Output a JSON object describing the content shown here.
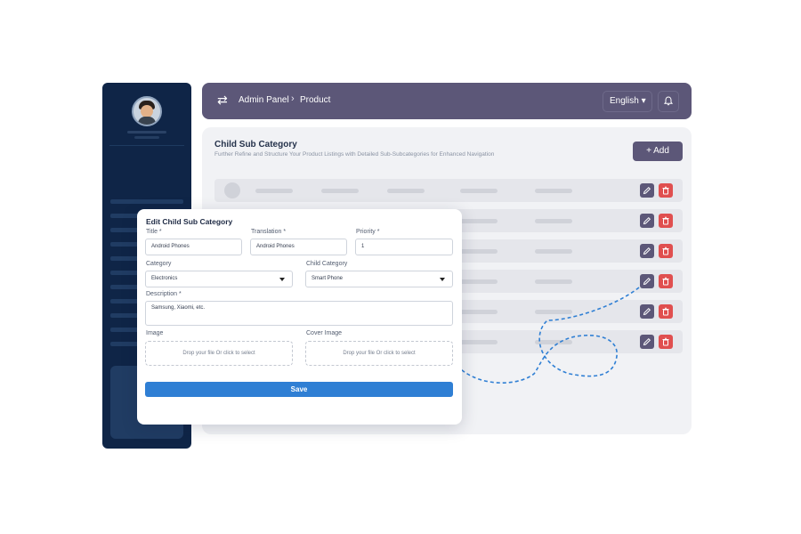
{
  "header": {
    "swap_icon": "⇄",
    "breadcrumb": [
      "Admin Panel",
      "Product"
    ],
    "breadcrumb_separator": "›",
    "language": "English ▾",
    "bell_icon": "bell-icon"
  },
  "main": {
    "title": "Child Sub Category",
    "subtitle": "Further Refine and Structure Your Product Listings with Detailed Sub-Subcategories for Enhanced Navigation",
    "add_label": "+ Add",
    "row_count": 6
  },
  "modal": {
    "title": "Edit Child Sub Category",
    "fields": {
      "title": {
        "label": "Title *",
        "value": "Android Phones"
      },
      "translation": {
        "label": "Translation *",
        "value": "Android Phones"
      },
      "priority": {
        "label": "Priority *",
        "value": "1"
      },
      "category": {
        "label": "Category",
        "value": "Electronics"
      },
      "child_category": {
        "label": "Child Category",
        "value": "Smart Phone"
      },
      "description": {
        "label": "Description *",
        "value": "Samsung, Xiaomi, etc."
      },
      "image": {
        "label": "Image",
        "placeholder": "Drop your file Or click to select"
      },
      "cover_image": {
        "label": "Cover Image",
        "placeholder": "Drop your file Or click to select"
      }
    },
    "save_label": "Save"
  },
  "colors": {
    "sidebar_bg": "#0f2547",
    "header_bg": "#5c5778",
    "edit_button": "#5c5778",
    "delete_button": "#e04f4f",
    "save_button": "#2f7fd4",
    "dashed_path": "#2f7fd4"
  }
}
